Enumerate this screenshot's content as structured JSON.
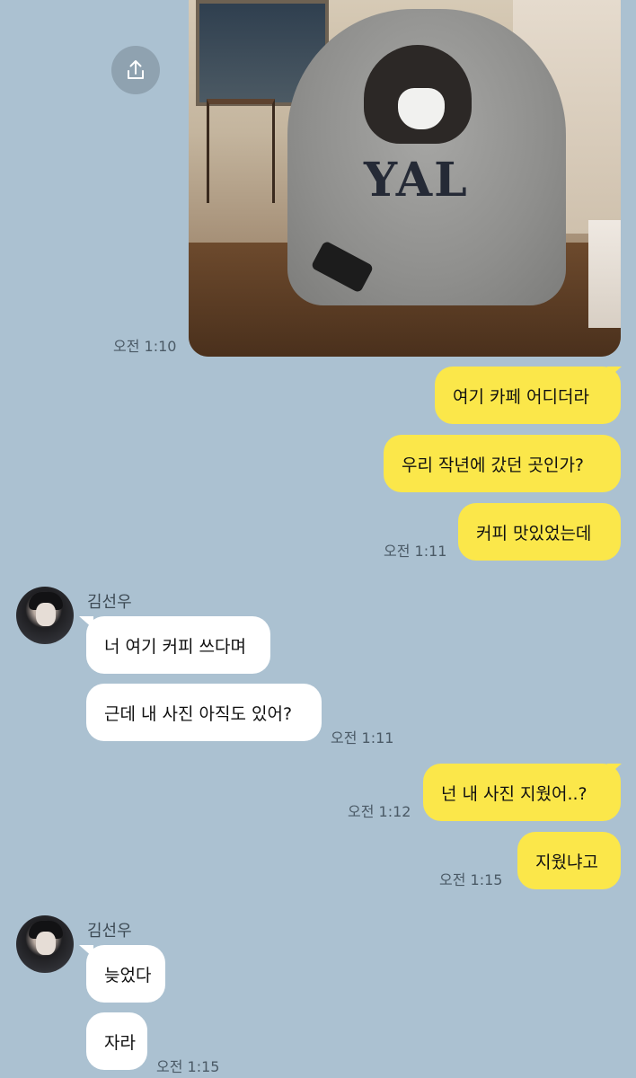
{
  "photo_message": {
    "time": "오전 1:10",
    "sweatshirt_text": "YAL"
  },
  "share_icon": "share-icon",
  "messages": [
    {
      "id": "m1",
      "text": "여기 카페 어디더라",
      "from": "me"
    },
    {
      "id": "m2",
      "text": "우리 작년에 갔던 곳인가?",
      "from": "me"
    },
    {
      "id": "m3",
      "text": "커피 맛있었는데",
      "from": "me",
      "time": "오전 1:11"
    },
    {
      "id": "m4",
      "text": "너 여기 커피 쓰다며",
      "from": "other"
    },
    {
      "id": "m5",
      "text": "근데 내 사진 아직도 있어?",
      "from": "other",
      "time": "오전 1:11"
    },
    {
      "id": "m6",
      "text": "넌 내 사진 지웠어..?",
      "from": "me",
      "time": "오전 1:12"
    },
    {
      "id": "m7",
      "text": "지웠냐고",
      "from": "me",
      "time": "오전 1:15"
    },
    {
      "id": "m8",
      "text": "늦었다",
      "from": "other"
    },
    {
      "id": "m9",
      "text": "자라",
      "from": "other",
      "time": "오전 1:15"
    }
  ],
  "sender": {
    "name": "김선우"
  },
  "colors": {
    "background": "#abc1d1",
    "my_bubble": "#fbe74a",
    "their_bubble": "#ffffff",
    "time_text": "#4b5a66"
  }
}
